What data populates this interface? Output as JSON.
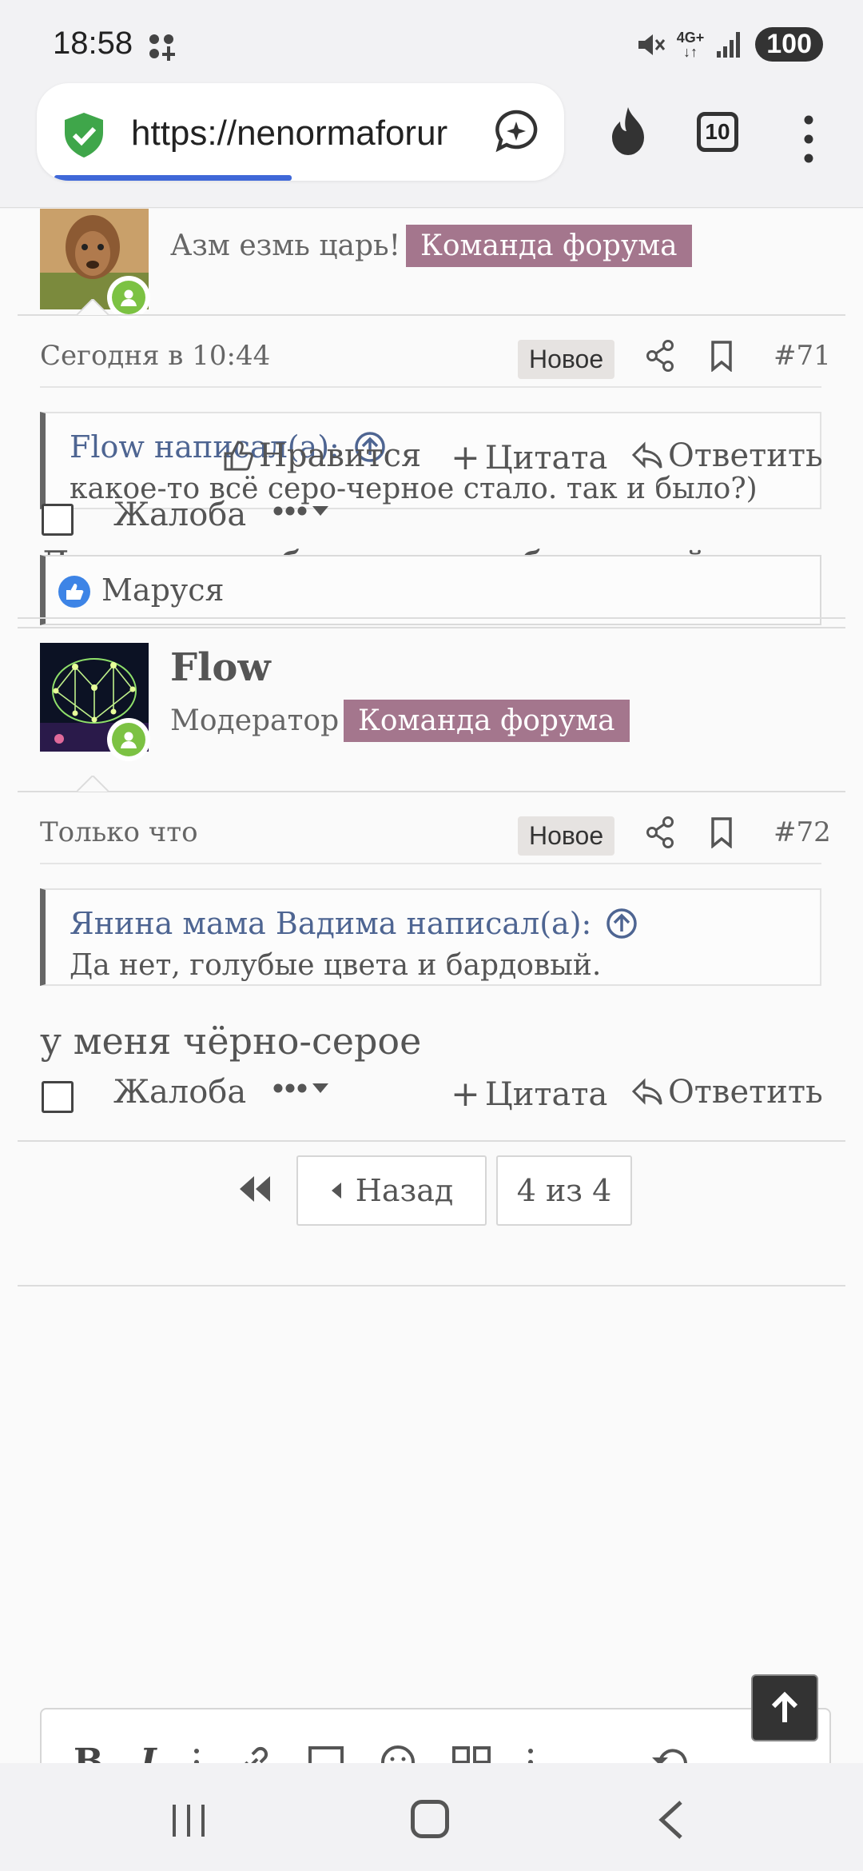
{
  "status_bar": {
    "time": "18:58",
    "network": "4G+",
    "battery": "100"
  },
  "browser": {
    "url": "https://nenormaforur",
    "tab_count": "10",
    "load_progress": 0.45
  },
  "post71": {
    "title": "Азм езмь царь!",
    "team_badge": "Команда форума",
    "date": "Сегодня в 10:44",
    "new_badge": "Новое",
    "number": "#71",
    "quote_author": "Flow написал(а):",
    "quote_text": "какое-то всё серо-черное стало. так и было?)",
    "body": "Да нет, голубые цвета и бардовый.",
    "like_label": "Нравится",
    "quote_label": "Цитата",
    "reply_label": "Ответить",
    "report_label": "Жалоба",
    "reactions_user": "Маруся"
  },
  "post72": {
    "username": "Flow",
    "title": "Модератор",
    "team_badge": "Команда форума",
    "date": "Только что",
    "new_badge": "Новое",
    "number": "#72",
    "quote_author": "Янина мама Вадима написал(а):",
    "quote_text": "Да нет, голубые цвета и бардовый.",
    "body": "у меня чёрно-серое",
    "quote_label": "Цитата",
    "reply_label": "Ответить",
    "report_label": "Жалоба"
  },
  "pagination": {
    "prev_label": "Назад",
    "page_info": "4 из 4"
  },
  "editor": {
    "bold": "B",
    "italic": "I"
  },
  "colors": {
    "accent": "#a4768d",
    "link": "#4e6592",
    "online": "#7cc243",
    "progress": "#3f68d8"
  }
}
